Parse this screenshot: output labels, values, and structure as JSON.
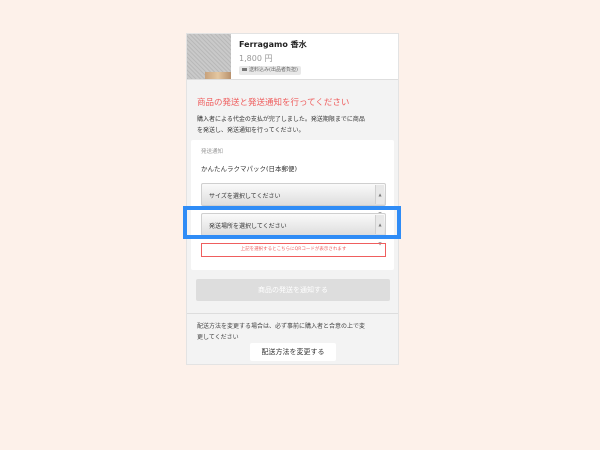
{
  "product": {
    "title": "Ferragamo 香水",
    "price": "1,800 円",
    "shipping_tag": "送料込み(出品者負担)",
    "shipping_icon": "truck-icon"
  },
  "instructions": {
    "heading": "商品の発送と発送通知を行ってください",
    "description_line1": "購入者による代金の支払が完了しました。発送期限までに商品",
    "description_line2": "を発送し、発送通知を行ってください。"
  },
  "shipment_form": {
    "label": "発送通知",
    "method": "かんたんラクマパック(日本郵便)",
    "size_select": "サイズを選択してください",
    "location_select": "発送場所を選択してください",
    "notice": "上記を選択するとこちらにQRコードが表示されます"
  },
  "actions": {
    "notify_button": "商品の発送を通知する",
    "change_note_line1": "配送方法を変更する場合は、必ず事前に購入者と合意の上で変",
    "change_note_line2": "更してください",
    "change_button": "配送方法を変更する"
  },
  "colors": {
    "page_background": "#fdf1ea",
    "accent_red": "#ef5e5e",
    "highlight_blue": "#2f8cf6",
    "disabled_button": "#dddddd"
  }
}
